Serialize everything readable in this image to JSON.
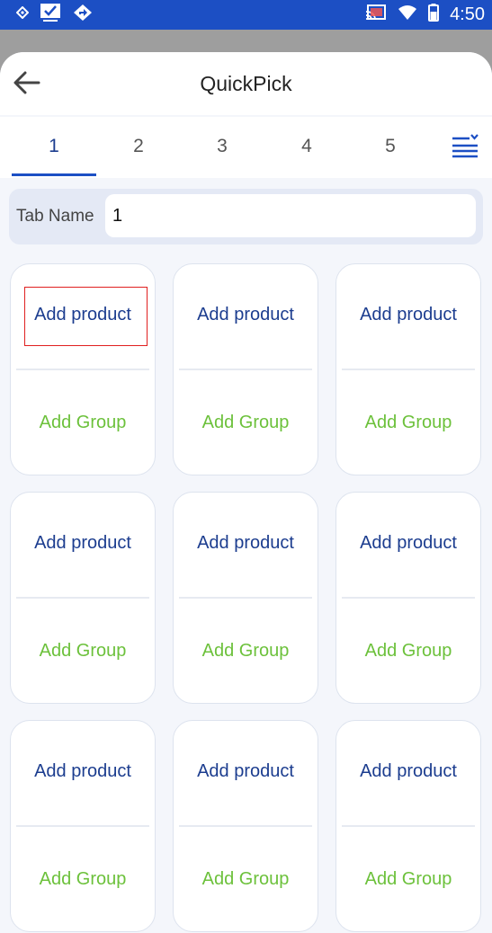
{
  "status_bar": {
    "time": "4:50",
    "left_icons": [
      "notification-diamond-icon",
      "checkbox-notification-icon",
      "directions-icon"
    ],
    "right_icons": [
      "cast-icon",
      "wifi-icon",
      "battery-icon"
    ]
  },
  "header": {
    "title": "QuickPick",
    "back_icon": "arrow-left-icon"
  },
  "tabs": {
    "items": [
      "1",
      "2",
      "3",
      "4",
      "5"
    ],
    "active_index": 0,
    "menu_icon": "list-collapse-icon"
  },
  "tab_name": {
    "label": "Tab Name",
    "value": "1"
  },
  "cards": [
    {
      "product": "Add product",
      "group": "Add Group"
    },
    {
      "product": "Add product",
      "group": "Add Group"
    },
    {
      "product": "Add product",
      "group": "Add Group"
    },
    {
      "product": "Add product",
      "group": "Add Group"
    },
    {
      "product": "Add product",
      "group": "Add Group"
    },
    {
      "product": "Add product",
      "group": "Add Group"
    },
    {
      "product": "Add product",
      "group": "Add Group"
    },
    {
      "product": "Add product",
      "group": "Add Group"
    },
    {
      "product": "Add product",
      "group": "Add Group"
    }
  ],
  "colors": {
    "status_bar": "#1c4fc4",
    "primary_text": "#1c3d8f",
    "group_text": "#6cc13b",
    "highlight": "#e02020"
  }
}
